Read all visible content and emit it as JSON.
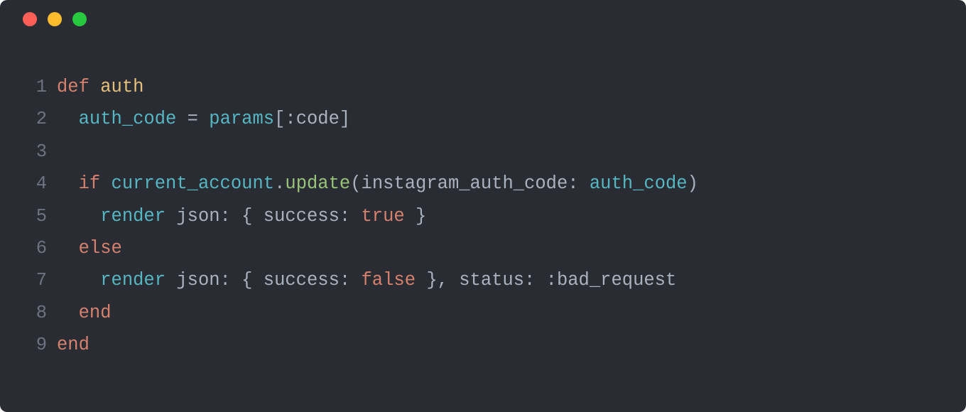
{
  "window": {
    "traffic_lights": [
      "close",
      "minimize",
      "zoom"
    ]
  },
  "colors": {
    "bg": "#292c33",
    "red": "#ff5f56",
    "yellow": "#ffbd2e",
    "green": "#27c93f",
    "lineno": "#6d7380",
    "text": "#abb2bf",
    "keyword": "#d6816e",
    "funcname": "#e5c07b",
    "variable": "#56b6c2",
    "method": "#98c379"
  },
  "code": {
    "language": "ruby",
    "lines": [
      {
        "n": "1",
        "tokens": [
          {
            "t": "def ",
            "c": "tok-kw"
          },
          {
            "t": "auth",
            "c": "tok-fn"
          }
        ]
      },
      {
        "n": "2",
        "tokens": [
          {
            "t": "  ",
            "c": "tok-plain"
          },
          {
            "t": "auth_code",
            "c": "tok-var"
          },
          {
            "t": " = ",
            "c": "tok-plain"
          },
          {
            "t": "params",
            "c": "tok-var"
          },
          {
            "t": "[:code]",
            "c": "tok-plain"
          }
        ]
      },
      {
        "n": "3",
        "tokens": [
          {
            "t": " ",
            "c": "tok-plain"
          }
        ]
      },
      {
        "n": "4",
        "tokens": [
          {
            "t": "  ",
            "c": "tok-plain"
          },
          {
            "t": "if ",
            "c": "tok-kw"
          },
          {
            "t": "current_account",
            "c": "tok-var"
          },
          {
            "t": ".",
            "c": "tok-plain"
          },
          {
            "t": "update",
            "c": "tok-call"
          },
          {
            "t": "(instagram_auth_code: ",
            "c": "tok-plain"
          },
          {
            "t": "auth_code",
            "c": "tok-var"
          },
          {
            "t": ")",
            "c": "tok-plain"
          }
        ]
      },
      {
        "n": "5",
        "tokens": [
          {
            "t": "    ",
            "c": "tok-plain"
          },
          {
            "t": "render",
            "c": "tok-var"
          },
          {
            "t": " json: { success: ",
            "c": "tok-plain"
          },
          {
            "t": "true",
            "c": "tok-kw"
          },
          {
            "t": " }",
            "c": "tok-plain"
          }
        ]
      },
      {
        "n": "6",
        "tokens": [
          {
            "t": "  ",
            "c": "tok-plain"
          },
          {
            "t": "else",
            "c": "tok-kw"
          }
        ]
      },
      {
        "n": "7",
        "tokens": [
          {
            "t": "    ",
            "c": "tok-plain"
          },
          {
            "t": "render",
            "c": "tok-var"
          },
          {
            "t": " json: { success: ",
            "c": "tok-plain"
          },
          {
            "t": "false",
            "c": "tok-kw"
          },
          {
            "t": " }, status: :bad_request",
            "c": "tok-plain"
          }
        ]
      },
      {
        "n": "8",
        "tokens": [
          {
            "t": "  ",
            "c": "tok-plain"
          },
          {
            "t": "end",
            "c": "tok-kw"
          }
        ]
      },
      {
        "n": "9",
        "tokens": [
          {
            "t": "end",
            "c": "tok-kw"
          }
        ]
      }
    ]
  }
}
